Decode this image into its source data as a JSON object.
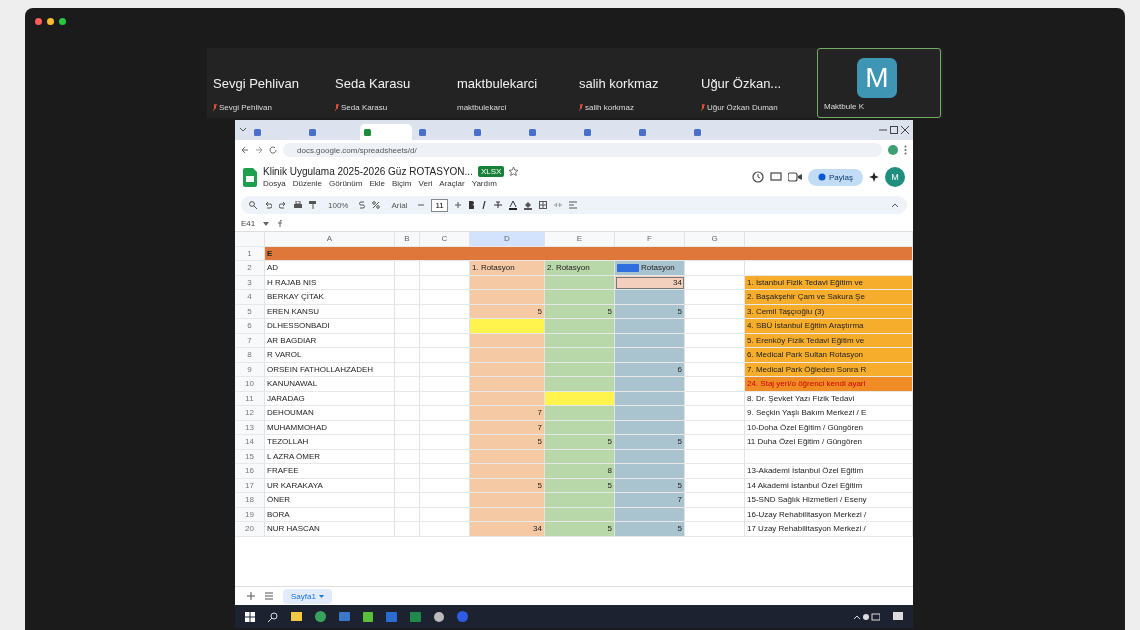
{
  "participants": [
    {
      "name": "Sevgi Pehlivan",
      "caption": "Sevgi Pehlivan",
      "muted": true,
      "selected": false
    },
    {
      "name": "Seda Karasu",
      "caption": "Seda Karasu",
      "muted": true,
      "selected": false
    },
    {
      "name": "maktbulekarci",
      "caption": "maktbulekarci",
      "muted": false,
      "selected": false
    },
    {
      "name": "salih korkmaz",
      "caption": "salih korkmaz",
      "muted": true,
      "selected": false
    },
    {
      "name": "Uğur Özkan...",
      "caption": "Uğur Özkan Duman",
      "muted": true,
      "selected": false
    },
    {
      "avatar": "M",
      "caption": "Maktbule K",
      "muted": false,
      "selected": true
    }
  ],
  "browser": {
    "tabs": [
      {
        "selected": false
      },
      {
        "selected": false
      },
      {
        "selected": true
      },
      {
        "selected": false
      },
      {
        "selected": false
      },
      {
        "selected": false
      },
      {
        "selected": false
      },
      {
        "selected": false
      },
      {
        "selected": false
      }
    ],
    "url": "docs.google.com/spreadsheets/d/"
  },
  "sheet": {
    "title": "Klinik Uygulama 2025-2026 Güz ROTASYON...",
    "badge": "XLSX",
    "menu": [
      "Dosya",
      "Düzenle",
      "Görünüm",
      "Ekle",
      "Biçim",
      "Veri",
      "Araçlar",
      "Yardım"
    ],
    "share": "Paylaş",
    "account": "M",
    "zoom": "100%",
    "font": "Arial",
    "font_size": "11",
    "cell_ref": "E41",
    "columns": [
      {
        "letter": "A",
        "selected": false
      },
      {
        "letter": "B",
        "selected": false
      },
      {
        "letter": "C",
        "selected": false
      },
      {
        "letter": "D",
        "selected": true
      },
      {
        "letter": "E",
        "selected": false
      },
      {
        "letter": "F",
        "selected": false
      },
      {
        "letter": "G",
        "selected": false
      }
    ],
    "rows": [
      {
        "number": "1",
        "kind": "banner",
        "name": "E"
      },
      {
        "number": "2",
        "kind": "header",
        "name": "AD",
        "rot1": "1. Rotasyon",
        "rot2": "2. Rotasyon",
        "rot3": "Rotasyon",
        "collaborator_cursor": true
      },
      {
        "number": "3",
        "kind": "data",
        "name": "H RAJAB NIS",
        "rot3": "34",
        "editing": true,
        "note": "1. İstanbul Fizik Tedavi Eğitim ve",
        "note_highlighted": true
      },
      {
        "number": "4",
        "kind": "data",
        "name": "BERKAY ÇİTAK",
        "note": "2. Başakşehir Çam ve Sakura Şe",
        "note_highlighted": true
      },
      {
        "number": "5",
        "kind": "data",
        "name": "EREN KANSU",
        "rot1": "5",
        "rot2": "5",
        "rot3": "5",
        "note": "3. Cemil Taşçıoğlu (3)",
        "note_highlighted": true
      },
      {
        "number": "6",
        "kind": "data",
        "name": "DLHESSONBADI",
        "rot1_marked": true,
        "note": "4. SBÜ İstanbul Eğitim Araştırma",
        "note_highlighted": true
      },
      {
        "number": "7",
        "kind": "data",
        "name": "AR BAGDIAR",
        "note": "5. Erenköy Fizik Tedavi Eğitim ve",
        "note_highlighted": true
      },
      {
        "number": "8",
        "kind": "data",
        "name": "R VAROL",
        "note": "6. Medical Park Sultan Rotasyon",
        "note_highlighted": true
      },
      {
        "number": "9",
        "kind": "data",
        "name": "ORSEIN FATHOLLAHZADEH",
        "rot3": "6",
        "note": "7. Medical Park Öğleden Sonra R",
        "note_highlighted": true
      },
      {
        "number": "10",
        "kind": "data",
        "name": "KANUNAWAL",
        "note": "24. Staj yeri/o öğrenci kendi ayarl",
        "note_highlighted": true,
        "note_alert": true
      },
      {
        "number": "11",
        "kind": "data",
        "name": "JARADAG",
        "rot2_marked": true,
        "note": "8. Dr. Şevket Yazı Fizik Tedavi"
      },
      {
        "number": "12",
        "kind": "data",
        "name": "DEHOUMAN",
        "rot1": "7",
        "note": "9. Seçkin Yaşlı Bakım Merkezi / E"
      },
      {
        "number": "13",
        "kind": "data",
        "name": "MUHAMMOHAD",
        "rot1": "7",
        "note": "10-Doha Özel Eğitim / Güngören"
      },
      {
        "number": "14",
        "kind": "data",
        "name": "TEZOLLAH",
        "rot1": "5",
        "rot2": "5",
        "rot3": "5",
        "note": "11 Duha Özel Eğitim / Güngören"
      },
      {
        "number": "15",
        "kind": "data",
        "name": "L AZRA ÖMER"
      },
      {
        "number": "16",
        "kind": "data",
        "name": "FRAFEE",
        "rot2": "8",
        "note": "13-Akademi İstanbul Özel Eğitim"
      },
      {
        "number": "17",
        "kind": "data",
        "name": "UR KARAKAYA",
        "rot1": "5",
        "rot2": "5",
        "rot3": "5",
        "note": "14 Akademi İstanbul Özel Eğitim"
      },
      {
        "number": "18",
        "kind": "data",
        "name": "ÖNER",
        "rot3": "7",
        "note": "15-SND Sağlık Hizmetleri / Eseny"
      },
      {
        "number": "19",
        "kind": "data",
        "name": "BORA",
        "note": "16-Uzay Rehabilitasyon Merkezi /"
      },
      {
        "number": "20",
        "kind": "data",
        "name": "NUR HASCAN",
        "rot1": "34",
        "rot2": "5",
        "rot3": "5",
        "note": "17 Uzay Rehabilitasyon Merkezi /"
      }
    ],
    "sheet_tab": "Sayfa1"
  }
}
